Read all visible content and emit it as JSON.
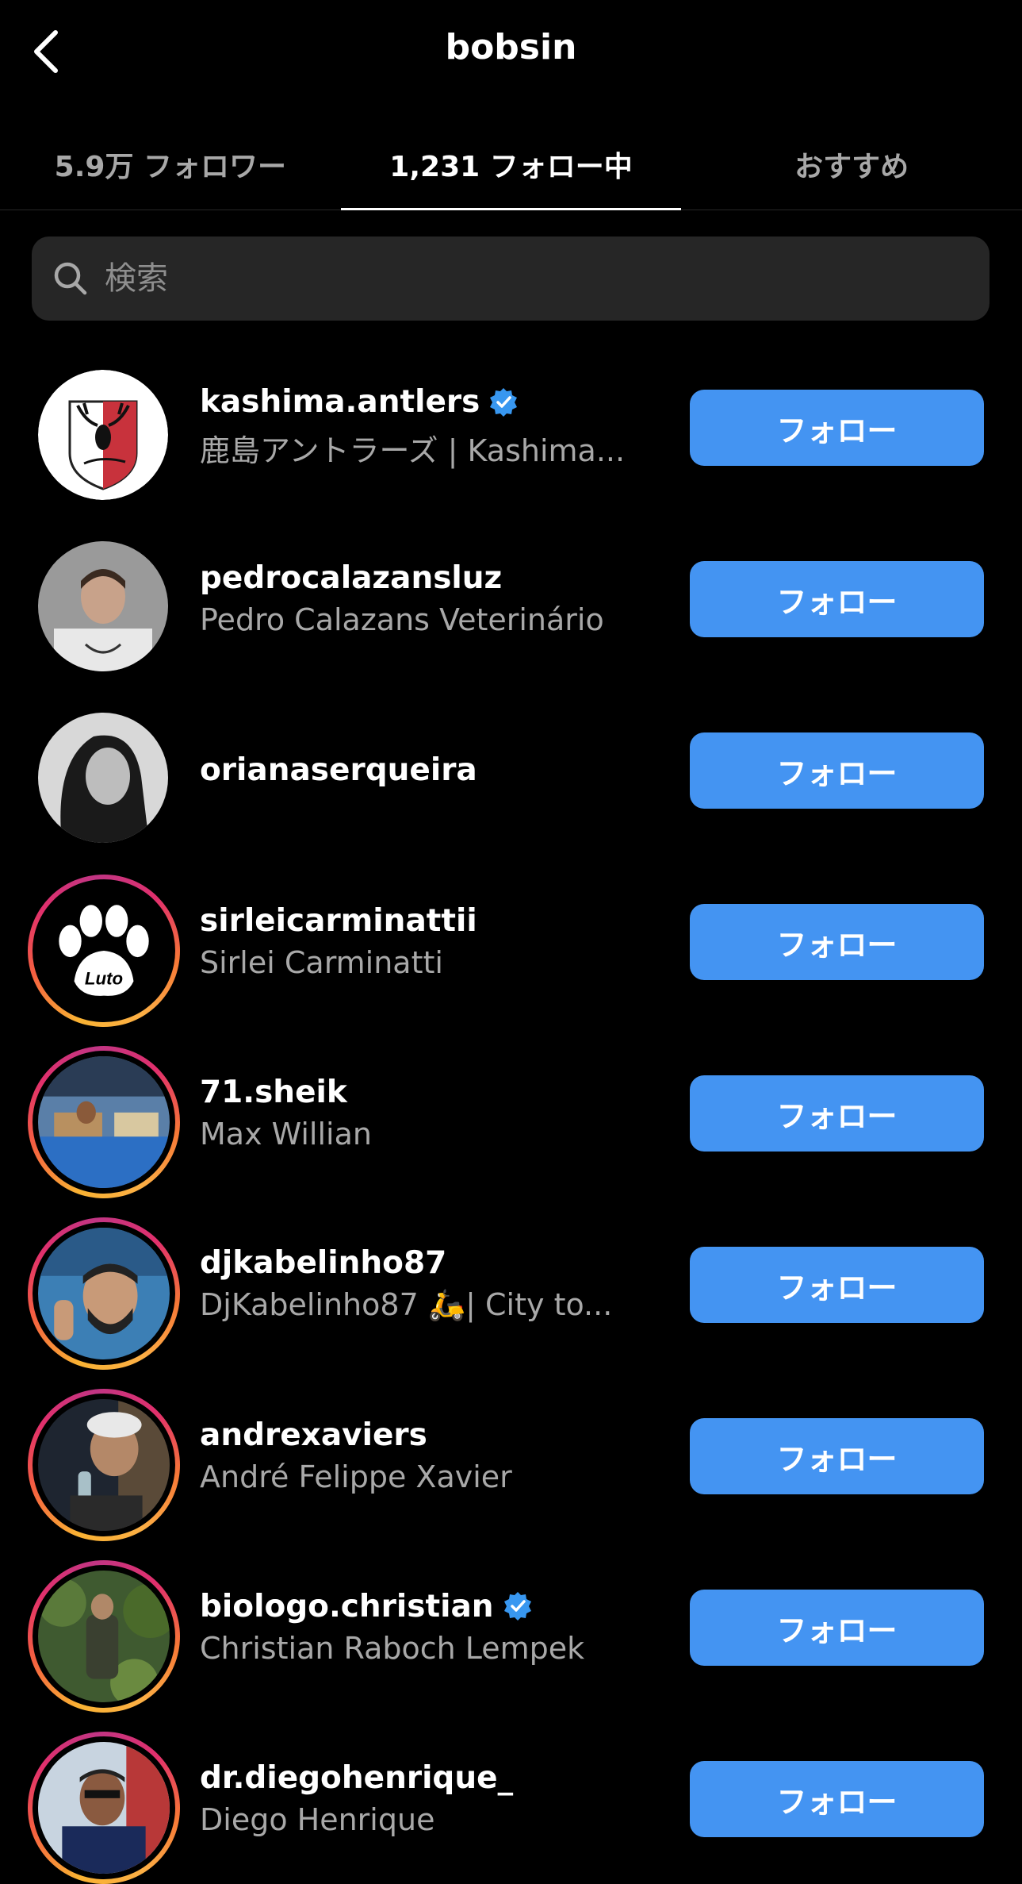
{
  "header": {
    "title": "bobsin"
  },
  "tabs": [
    {
      "label": "5.9万 フォロワー",
      "active": false
    },
    {
      "label": "1,231 フォロー中",
      "active": true
    },
    {
      "label": "おすすめ",
      "active": false
    }
  ],
  "search": {
    "placeholder": "検索"
  },
  "follow_label": "フォロー",
  "accounts": [
    {
      "username": "kashima.antlers",
      "fullname": "鹿島アントラーズ | Kashima...",
      "verified": true,
      "story_ring": false
    },
    {
      "username": "pedrocalazansluz",
      "fullname": "Pedro Calazans Veterinário",
      "verified": false,
      "story_ring": false
    },
    {
      "username": "orianaserqueira",
      "fullname": "",
      "verified": false,
      "story_ring": false
    },
    {
      "username": "sirleicarminattii",
      "fullname": "Sirlei Carminatti",
      "verified": false,
      "story_ring": true,
      "avatar_text": "Luto"
    },
    {
      "username": "71.sheik",
      "fullname": "Max Willian",
      "verified": false,
      "story_ring": true
    },
    {
      "username": "djkabelinho87",
      "fullname": "DjKabelinho87 🛵| City to...",
      "verified": false,
      "story_ring": true
    },
    {
      "username": "andrexaviers",
      "fullname": "André Felippe Xavier",
      "verified": false,
      "story_ring": true
    },
    {
      "username": "biologo.christian",
      "fullname": "Christian Raboch Lempek",
      "verified": true,
      "story_ring": true
    },
    {
      "username": "dr.diegohenrique_",
      "fullname": "Diego Henrique",
      "verified": false,
      "story_ring": true
    }
  ],
  "colors": {
    "background": "#000000",
    "button": "#4494f2",
    "secondary_text": "#a8a8a8",
    "verified": "#3897f0"
  }
}
